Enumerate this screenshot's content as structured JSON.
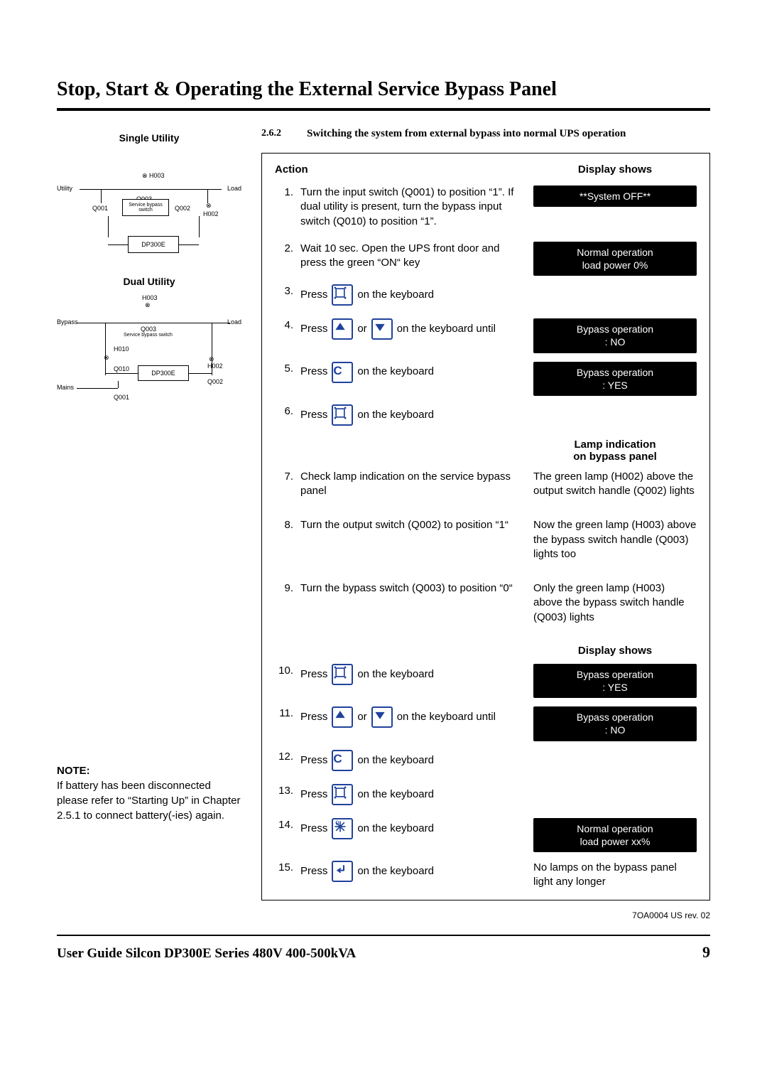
{
  "title": "Stop, Start & Operating the External Service Bypass Panel",
  "left": {
    "single_utility": "Single Utility",
    "dual_utility": "Dual Utility",
    "dia1": {
      "utility": "Utility",
      "load": "Load",
      "h003": "H003",
      "q001": "Q001",
      "q003": "Q003",
      "q002": "Q002",
      "h002": "H002",
      "sbs": "Service bypass switch",
      "dp": "DP300E"
    },
    "dia2": {
      "bypass": "Bypass",
      "mains": "Mains",
      "load": "Load",
      "h003": "H003",
      "q003": "Q003",
      "sbs": "Service bypass switch",
      "h010": "H010",
      "q010": "Q010",
      "h002": "H002",
      "q002": "Q002",
      "q001": "Q001",
      "dp": "DP300E"
    },
    "note_label": "NOTE:",
    "note_text": "If battery has been disconnected please refer to “Starting Up” in Chapter 2.5.1 to connect battery(-ies) again."
  },
  "section": {
    "num": "2.6.2",
    "title": "Switching the system from external bypass into normal UPS operation"
  },
  "panel": {
    "action_label": "Action",
    "display_label": "Display shows",
    "lamp_label1": "Lamp indication",
    "lamp_label2": "on bypass panel",
    "display_label2": "Display shows",
    "steps": {
      "s1": {
        "n": "1.",
        "t": "Turn the input switch (Q001) to position “1”. If dual utility is present, turn the bypass input switch (Q010) to position “1”."
      },
      "s2": {
        "n": "2.",
        "t": "Wait 10 sec. Open the UPS front door and press the green “ON“ key"
      },
      "s3": {
        "n": "3.",
        "a": "Press",
        "b": "on the keyboard"
      },
      "s4": {
        "n": "4.",
        "a": "Press",
        "or": "or",
        "b": "on the keyboard until"
      },
      "s5": {
        "n": "5.",
        "a": "Press",
        "b": "on the keyboard"
      },
      "s6": {
        "n": "6.",
        "a": "Press",
        "b": "on the keyboard"
      },
      "s7": {
        "n": "7.",
        "t": "Check lamp indication on the service bypass panel"
      },
      "s8": {
        "n": "8.",
        "t": "Turn the output switch (Q002) to position “1“"
      },
      "s9": {
        "n": "9.",
        "t": "Turn the bypass switch (Q003) to position “0“"
      },
      "s10": {
        "n": "10.",
        "a": "Press",
        "b": "on the keyboard"
      },
      "s11": {
        "n": "11.",
        "a": "Press",
        "or": "or",
        "b": "on the keyboard until"
      },
      "s12": {
        "n": "12.",
        "a": "Press",
        "b": "on the keyboard"
      },
      "s13": {
        "n": "13.",
        "a": "Press",
        "b": "on the keyboard"
      },
      "s14": {
        "n": "14.",
        "a": "Press",
        "b": "on the keyboard"
      },
      "s15": {
        "n": "15.",
        "a": "Press",
        "b": "on the keyboard"
      }
    },
    "displays": {
      "d1": {
        "l1": "**System OFF**"
      },
      "d2": {
        "l1": "Normal operation",
        "l2": "load power 0%"
      },
      "d4": {
        "l1": "Bypass operation",
        "l2": ": NO"
      },
      "d5": {
        "l1": "Bypass operation",
        "l2": ": YES"
      },
      "l7": "The green lamp (H002) above the output switch handle (Q002) lights",
      "l8": "Now the green lamp (H003) above the bypass switch handle (Q003) lights too",
      "l9": "Only the green lamp (H003) above the bypass switch handle (Q003) lights",
      "d10": {
        "l1": "Bypass operation",
        "l2": ": YES"
      },
      "d11": {
        "l1": "Bypass operation",
        "l2": ": NO"
      },
      "d14": {
        "l1": "Normal operation",
        "l2": "load power xx%"
      },
      "l15": "No lamps on the bypass panel light any longer"
    }
  },
  "footer": {
    "rev": "7OA0004 US rev. 02",
    "guide": "User Guide Silcon DP300E Series 480V 400-500kVA",
    "page": "9"
  }
}
